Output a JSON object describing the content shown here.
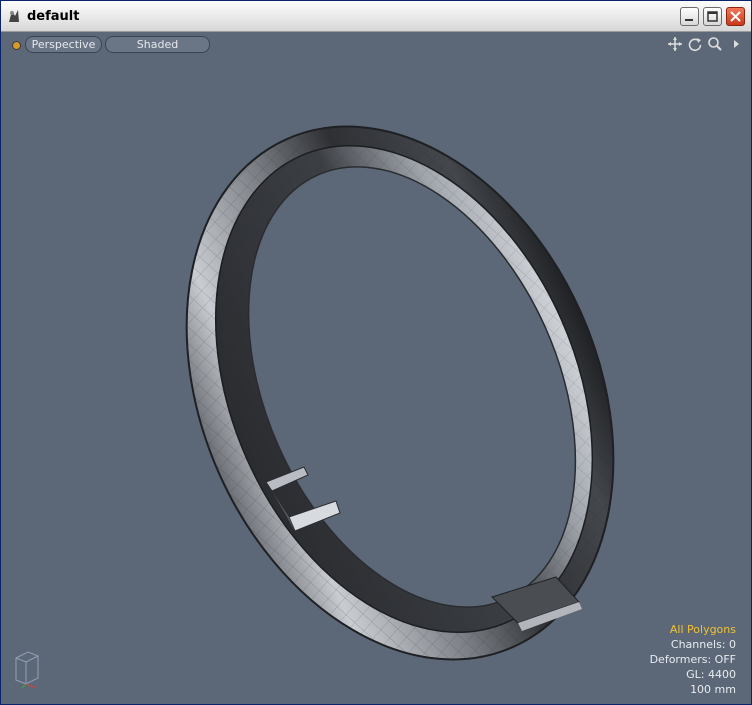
{
  "window": {
    "title": "default"
  },
  "viewport": {
    "view_mode": "Perspective",
    "shading_mode": "Shaded",
    "background_color": "#5c6878"
  },
  "nav_icons": [
    "move-icon",
    "rotate-icon",
    "zoom-icon",
    "menu-arrow-icon"
  ],
  "hud": {
    "selection_mode": "All Polygons",
    "channels": "Channels: 0",
    "deformers": "Deformers: OFF",
    "gl": "GL: 4400",
    "scale": "100 mm"
  },
  "colors": {
    "accent": "#f2c230",
    "title_close": "#c8381c"
  }
}
